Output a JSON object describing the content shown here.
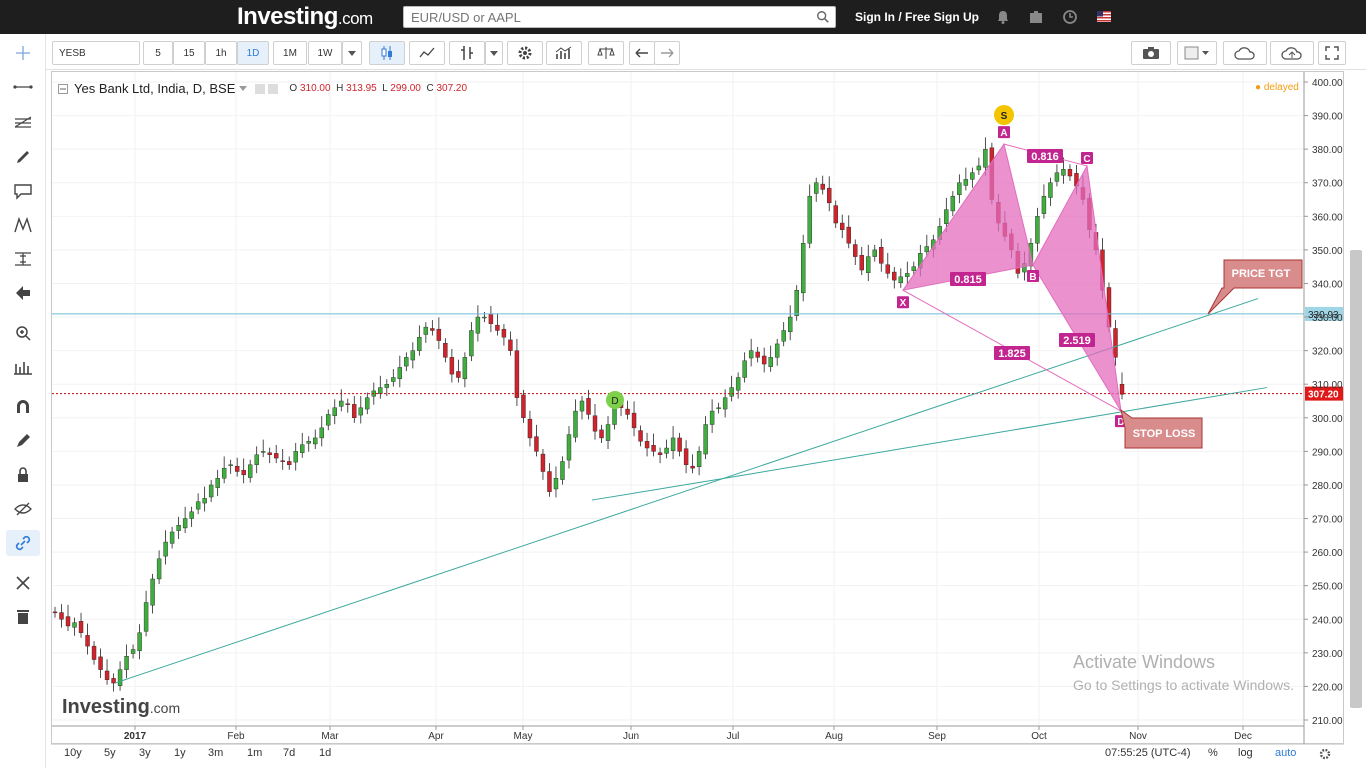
{
  "header": {
    "logo_main": "Investing",
    "logo_suffix": ".com",
    "search_placeholder": "EUR/USD or AAPL",
    "signin_label": "Sign In / Free Sign Up",
    "icons": [
      "bell-icon",
      "briefcase-icon",
      "clock-icon",
      "us-flag-icon"
    ]
  },
  "left_tools": [
    "crosshair-icon",
    "trend-line-icon",
    "fib-icon",
    "brush-icon",
    "callout-icon",
    "pattern-icon",
    "measure-icon",
    "arrow-left-icon",
    "zoom-icon",
    "ruler-icon",
    "magnet-icon",
    "pencil-icon",
    "lock-icon",
    "eye-off-icon",
    "link-icon",
    "wrench-icon",
    "trash-icon"
  ],
  "toolbar": {
    "symbol": "YESB",
    "intervals": [
      "5",
      "15",
      "1h",
      "1D",
      "1M",
      "1W"
    ],
    "selected_interval": "1D"
  },
  "legend": {
    "title": "Yes Bank Ltd, India, D, BSE",
    "o_label": "O",
    "o": "310.00",
    "h_label": "H",
    "h": "313.95",
    "l_label": "L",
    "l": "299.00",
    "c_label": "C",
    "c": "307.20",
    "delayed": "delayed"
  },
  "chart_data": {
    "type": "candlestick",
    "ylim": [
      210,
      400
    ],
    "y_ticks": [
      "400.00",
      "390.00",
      "380.00",
      "370.00",
      "360.00",
      "350.00",
      "340.00",
      "330.00",
      "320.00",
      "310.00",
      "300.00",
      "290.00",
      "280.00",
      "270.00",
      "260.00",
      "250.00",
      "240.00",
      "230.00",
      "220.00",
      "210.00"
    ],
    "x_ticks": [
      "2017",
      "Feb",
      "Mar",
      "Apr",
      "May",
      "Jun",
      "Jul",
      "Aug",
      "Sep",
      "Oct",
      "Nov",
      "Dec"
    ],
    "price_labels": {
      "last": "307.20",
      "level": "330.93"
    },
    "colors": {
      "up": "#3fae3f",
      "down": "#d0232b",
      "pattern": "#e36cbd",
      "trend": "#3aa89c",
      "hline": "#6bbdd6",
      "lastline": "#c00"
    },
    "pattern_points": {
      "X": 338,
      "A": 381.5,
      "B": 345.5,
      "C": 375,
      "D": 302
    },
    "pattern_labels": [
      "X",
      "A",
      "B",
      "C",
      "D"
    ],
    "ratio_labels": [
      "0.816",
      "0.815",
      "2.519",
      "1.825"
    ],
    "marker_s": "S",
    "marker_d": "D",
    "annotations": [
      "PRICE TGT",
      "STOP LOSS"
    ],
    "closes": [
      242,
      240,
      238,
      239,
      236,
      232,
      228,
      225,
      222,
      221,
      225,
      229,
      231,
      236,
      245,
      252,
      258,
      263,
      266,
      268,
      270,
      272,
      275,
      276,
      280,
      282,
      285,
      286,
      284,
      283,
      286,
      289,
      290,
      289,
      288,
      287,
      286,
      290,
      292,
      293,
      294,
      297,
      301,
      303,
      305,
      304,
      300,
      303,
      306,
      308,
      309,
      310,
      312,
      315,
      318,
      320,
      324,
      327,
      326,
      323,
      318,
      313,
      312,
      318,
      326,
      330,
      330,
      328,
      326,
      324,
      320,
      306,
      300,
      294,
      290,
      284,
      278,
      282,
      287,
      295,
      302,
      305,
      301,
      296,
      294,
      298,
      304,
      303,
      301,
      297,
      293,
      291,
      290,
      289,
      291,
      294,
      290,
      286,
      285,
      290,
      298,
      302,
      303,
      306,
      309,
      312,
      317,
      320,
      318,
      316,
      318,
      322,
      326,
      330,
      338,
      352,
      366,
      370,
      368,
      364,
      358,
      356,
      352,
      348,
      344,
      348,
      350,
      346,
      343,
      341,
      342,
      343,
      345,
      349,
      351,
      353,
      357,
      362,
      366,
      370,
      371,
      373,
      375,
      380,
      365,
      358,
      354,
      350,
      343,
      346,
      352,
      360,
      366,
      370,
      373,
      374,
      372,
      369,
      365,
      356,
      350,
      338,
      327,
      318,
      307
    ]
  },
  "bottom": {
    "ranges": [
      "10y",
      "5y",
      "3y",
      "1y",
      "3m",
      "1m",
      "7d",
      "1d"
    ],
    "time": "07:55:25 (UTC-4)",
    "percent": "%",
    "log": "log",
    "auto": "auto"
  },
  "watermark": {
    "line1": "Activate Windows",
    "line2": "Go to Settings to activate Windows.",
    "logo_main": "Investing",
    "logo_suffix": ".com"
  }
}
